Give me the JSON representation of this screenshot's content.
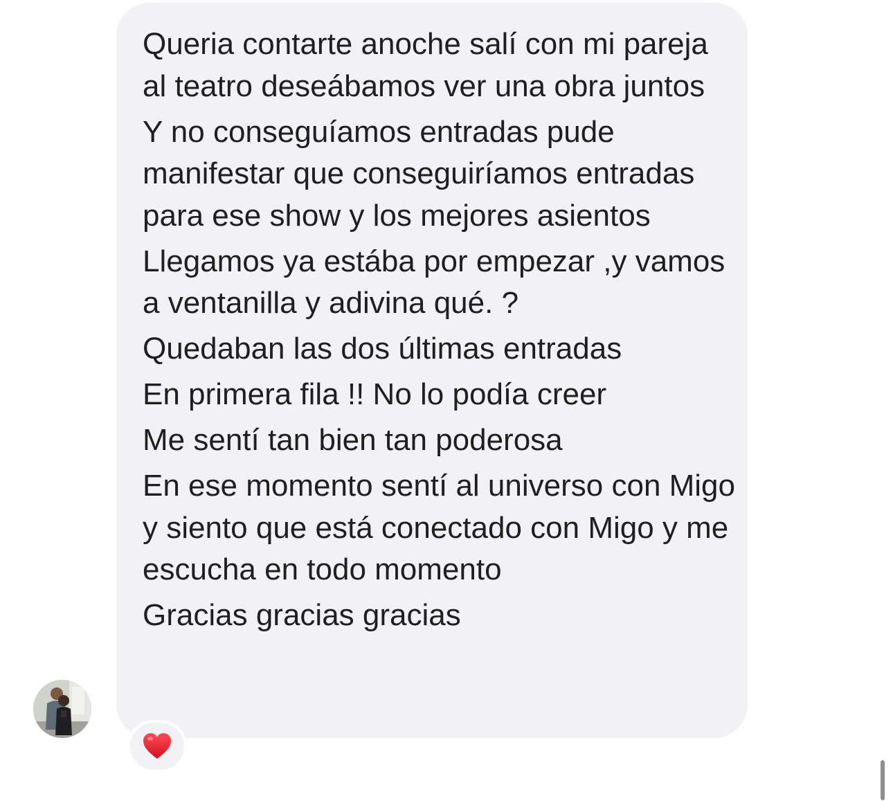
{
  "message": {
    "paragraphs": [
      "Queria contarte anoche salí con mi pareja al teatro deseábamos ver una obra juntos",
      "Y no conseguíamos entradas pude manifestar que conseguiríamos entradas para ese show y los mejores asientos",
      "Llegamos ya estába por empezar ,y vamos a ventanilla y adivina qué. ?",
      "Quedaban las dos últimas entradas",
      "En primera fila !! No lo podía creer",
      "Me sentí tan bien tan poderosa",
      "En ese momento sentí al universo con Migo y siento que está conectado con Migo y me escucha en todo momento",
      "Gracias gracias gracias"
    ],
    "bubble_color": "#f2f2f6",
    "text_color": "#1f1f1f"
  },
  "sender": {
    "avatar_icon": "profile-photo"
  },
  "reaction": {
    "icon": "red-heart-icon",
    "color": "#e8202f"
  }
}
